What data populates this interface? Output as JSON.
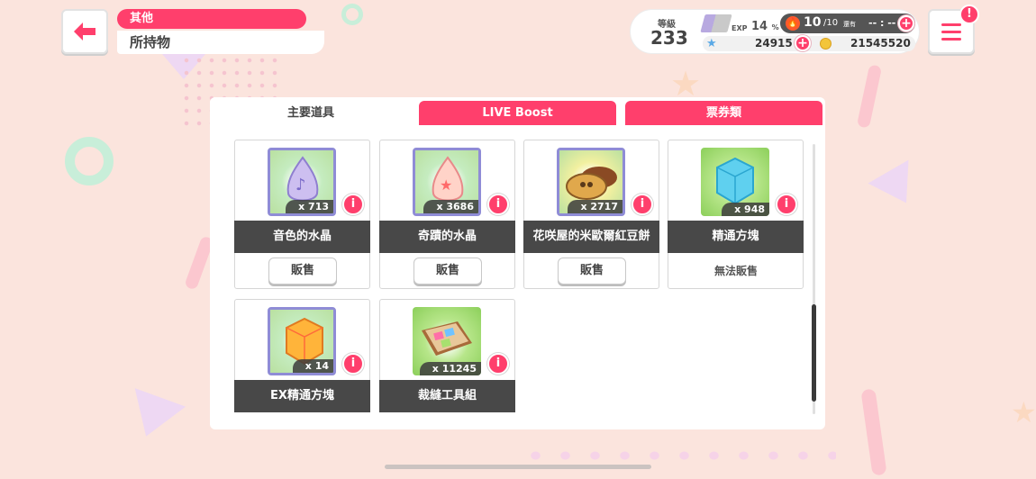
{
  "header": {
    "category": "其他",
    "title": "所持物"
  },
  "status": {
    "level_label": "等級",
    "level": "233",
    "exp_label": "EXP",
    "exp_value": "14",
    "exp_unit": "%",
    "stamina": "10",
    "stamina_max": "/10",
    "stamina_recover_label": "還有",
    "stamina_time": "-- : --",
    "gems": "24915",
    "coins": "21545520"
  },
  "tabs": [
    {
      "label": "主要道具",
      "active": true
    },
    {
      "label": "LIVE Boost",
      "active": false
    },
    {
      "label": "票券類",
      "active": false
    }
  ],
  "items": [
    {
      "name": "音色的水晶",
      "qty": "x 713",
      "action": "販售",
      "icon": "purple-crystal-icon"
    },
    {
      "name": "奇蹟的水晶",
      "qty": "x 3686",
      "action": "販售",
      "icon": "pink-crystal-icon"
    },
    {
      "name": "花咲屋的米歐爾紅豆餅",
      "qty": "x 2717",
      "action": "販售",
      "icon": "bean-cake-icon"
    },
    {
      "name": "精通方塊",
      "qty": "x 948",
      "action": "無法販售",
      "icon": "blue-cube-icon"
    },
    {
      "name": "EX精通方塊",
      "qty": "x 14",
      "action": "",
      "icon": "gold-cube-icon"
    },
    {
      "name": "裁縫工具組",
      "qty": "x 11245",
      "action": "",
      "icon": "sewing-kit-icon"
    }
  ],
  "info_glyph": "i",
  "colors": {
    "accent": "#ff3f6c",
    "background": "#fbe4dd",
    "name_bar": "#484848"
  }
}
